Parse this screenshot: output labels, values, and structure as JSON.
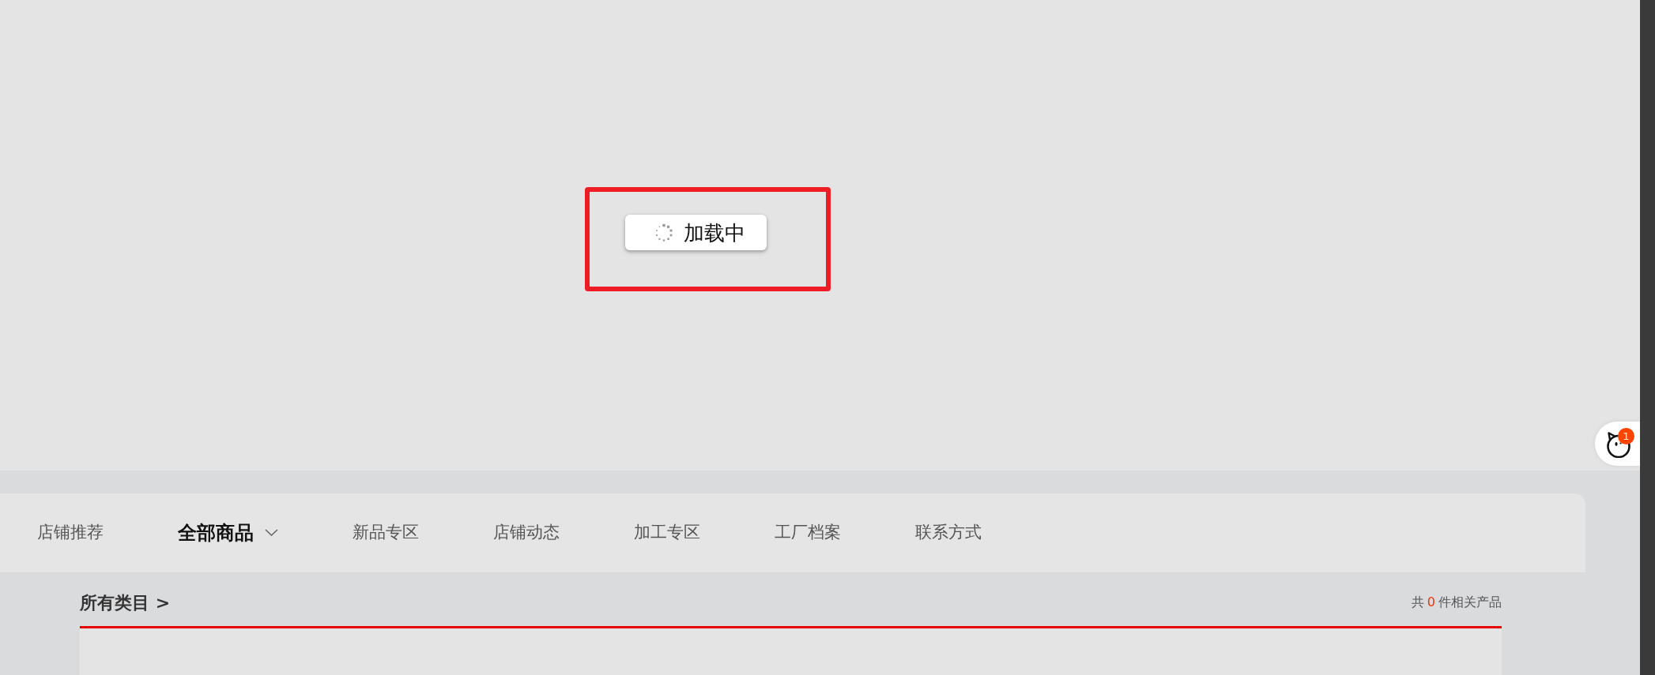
{
  "loading": {
    "text": "加载中"
  },
  "assistant": {
    "badge": "1"
  },
  "nav": {
    "items": [
      {
        "label": "店铺推荐",
        "selected": false,
        "dropdown": false
      },
      {
        "label": "全部商品",
        "selected": true,
        "dropdown": true
      },
      {
        "label": "新品专区",
        "selected": false,
        "dropdown": false
      },
      {
        "label": "店铺动态",
        "selected": false,
        "dropdown": false
      },
      {
        "label": "加工专区",
        "selected": false,
        "dropdown": false
      },
      {
        "label": "工厂档案",
        "selected": false,
        "dropdown": false
      },
      {
        "label": "联系方式",
        "selected": false,
        "dropdown": false
      }
    ]
  },
  "category": {
    "title": "所有类目 >",
    "count_prefix": "共",
    "count": "0",
    "count_suffix": "件相关产品"
  }
}
